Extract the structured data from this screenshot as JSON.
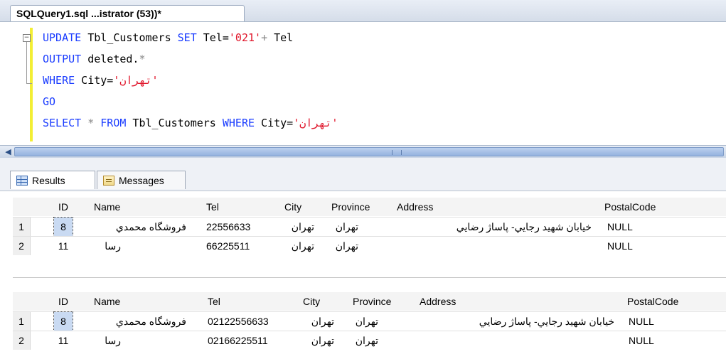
{
  "document_tab": {
    "title": "SQLQuery1.sql ...istrator (53))*"
  },
  "editor": {
    "line1": {
      "kw1": "UPDATE",
      "id1": " Tbl_Customers ",
      "kw2": "SET",
      "id2": " Tel=",
      "str": "'021'",
      "op": "+",
      "id3": " Tel"
    },
    "line2": {
      "kw1": "OUTPUT",
      "id1": " deleted.",
      "op": "*"
    },
    "line3": {
      "kw1": "WHERE",
      "id1": " City=",
      "str": "'تهران'"
    },
    "line4": {
      "kw1": "GO"
    },
    "line5": {
      "kw1": "SELECT",
      "op1": " * ",
      "kw2": "FROM",
      "id1": " Tbl_Customers ",
      "kw3": "WHERE",
      "id2": " City=",
      "str": "'تهران'"
    }
  },
  "results_tabs": {
    "results": "Results",
    "messages": "Messages"
  },
  "columns": [
    "ID",
    "Name",
    "Tel",
    "City",
    "Province",
    "Address",
    "PostalCode"
  ],
  "grid1": {
    "rows": [
      {
        "num": "1",
        "id": "8",
        "name": "فروشگاه محمدي",
        "tel": "22556633",
        "city": "تهران",
        "province": "تهران",
        "address": "خيابان شهيد رجايي- پاساژ رضايي",
        "postal": "NULL"
      },
      {
        "num": "2",
        "id": "11",
        "name": "رسا",
        "tel": "66225511",
        "city": "تهران",
        "province": "تهران",
        "address": "",
        "postal": "NULL"
      }
    ]
  },
  "grid2": {
    "rows": [
      {
        "num": "1",
        "id": "8",
        "name": "فروشگاه محمدي",
        "tel": "02122556633",
        "city": "تهران",
        "province": "تهران",
        "address": "خيابان شهيد رجايي- پاساژ رضايي",
        "postal": "NULL"
      },
      {
        "num": "2",
        "id": "11",
        "name": "رسا",
        "tel": "02166225511",
        "city": "تهران",
        "province": "تهران",
        "address": "",
        "postal": "NULL"
      }
    ]
  }
}
